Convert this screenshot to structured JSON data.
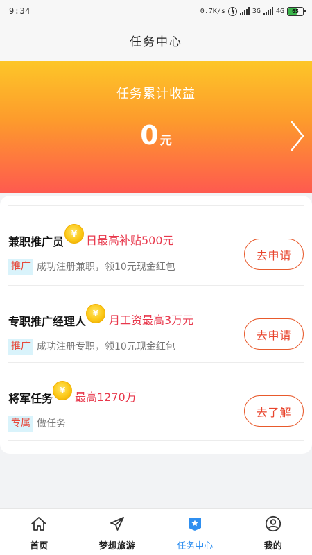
{
  "status_bar": {
    "time": "9:34",
    "net_speed": "0.7K/s",
    "signal_1": "3G",
    "signal_2": "4G",
    "battery": "65",
    "battery_level": 65
  },
  "header": {
    "title": "任务中心"
  },
  "banner": {
    "title": "任务累计收益",
    "amount": "0",
    "unit": "元"
  },
  "tasks": [
    {
      "name": "兼职推广员",
      "reward": "日最高补贴500元",
      "tag": "推广",
      "desc": "成功注册兼职，领10元现金红包",
      "button": "去申请"
    },
    {
      "name": "专职推广经理人",
      "reward": "月工资最高3万元",
      "tag": "推广",
      "desc": "成功注册专职，领10元现金红包",
      "button": "去申请"
    },
    {
      "name": "将军任务",
      "reward": "最高1270万",
      "tag": "专属",
      "desc": "做任务",
      "button": "去了解"
    }
  ],
  "coin_symbol": "¥",
  "nav": [
    {
      "label": "首页",
      "icon": "home-icon"
    },
    {
      "label": "梦想旅游",
      "icon": "paper-plane-icon"
    },
    {
      "label": "任务中心",
      "icon": "task-badge-icon",
      "active": true
    },
    {
      "label": "我的",
      "icon": "user-icon"
    }
  ],
  "colors": {
    "accent": "#2f8ff0",
    "reward": "#e8384c",
    "button": "#e8442c",
    "banner_top": "#fdc628",
    "banner_bottom": "#fe5a4f"
  }
}
